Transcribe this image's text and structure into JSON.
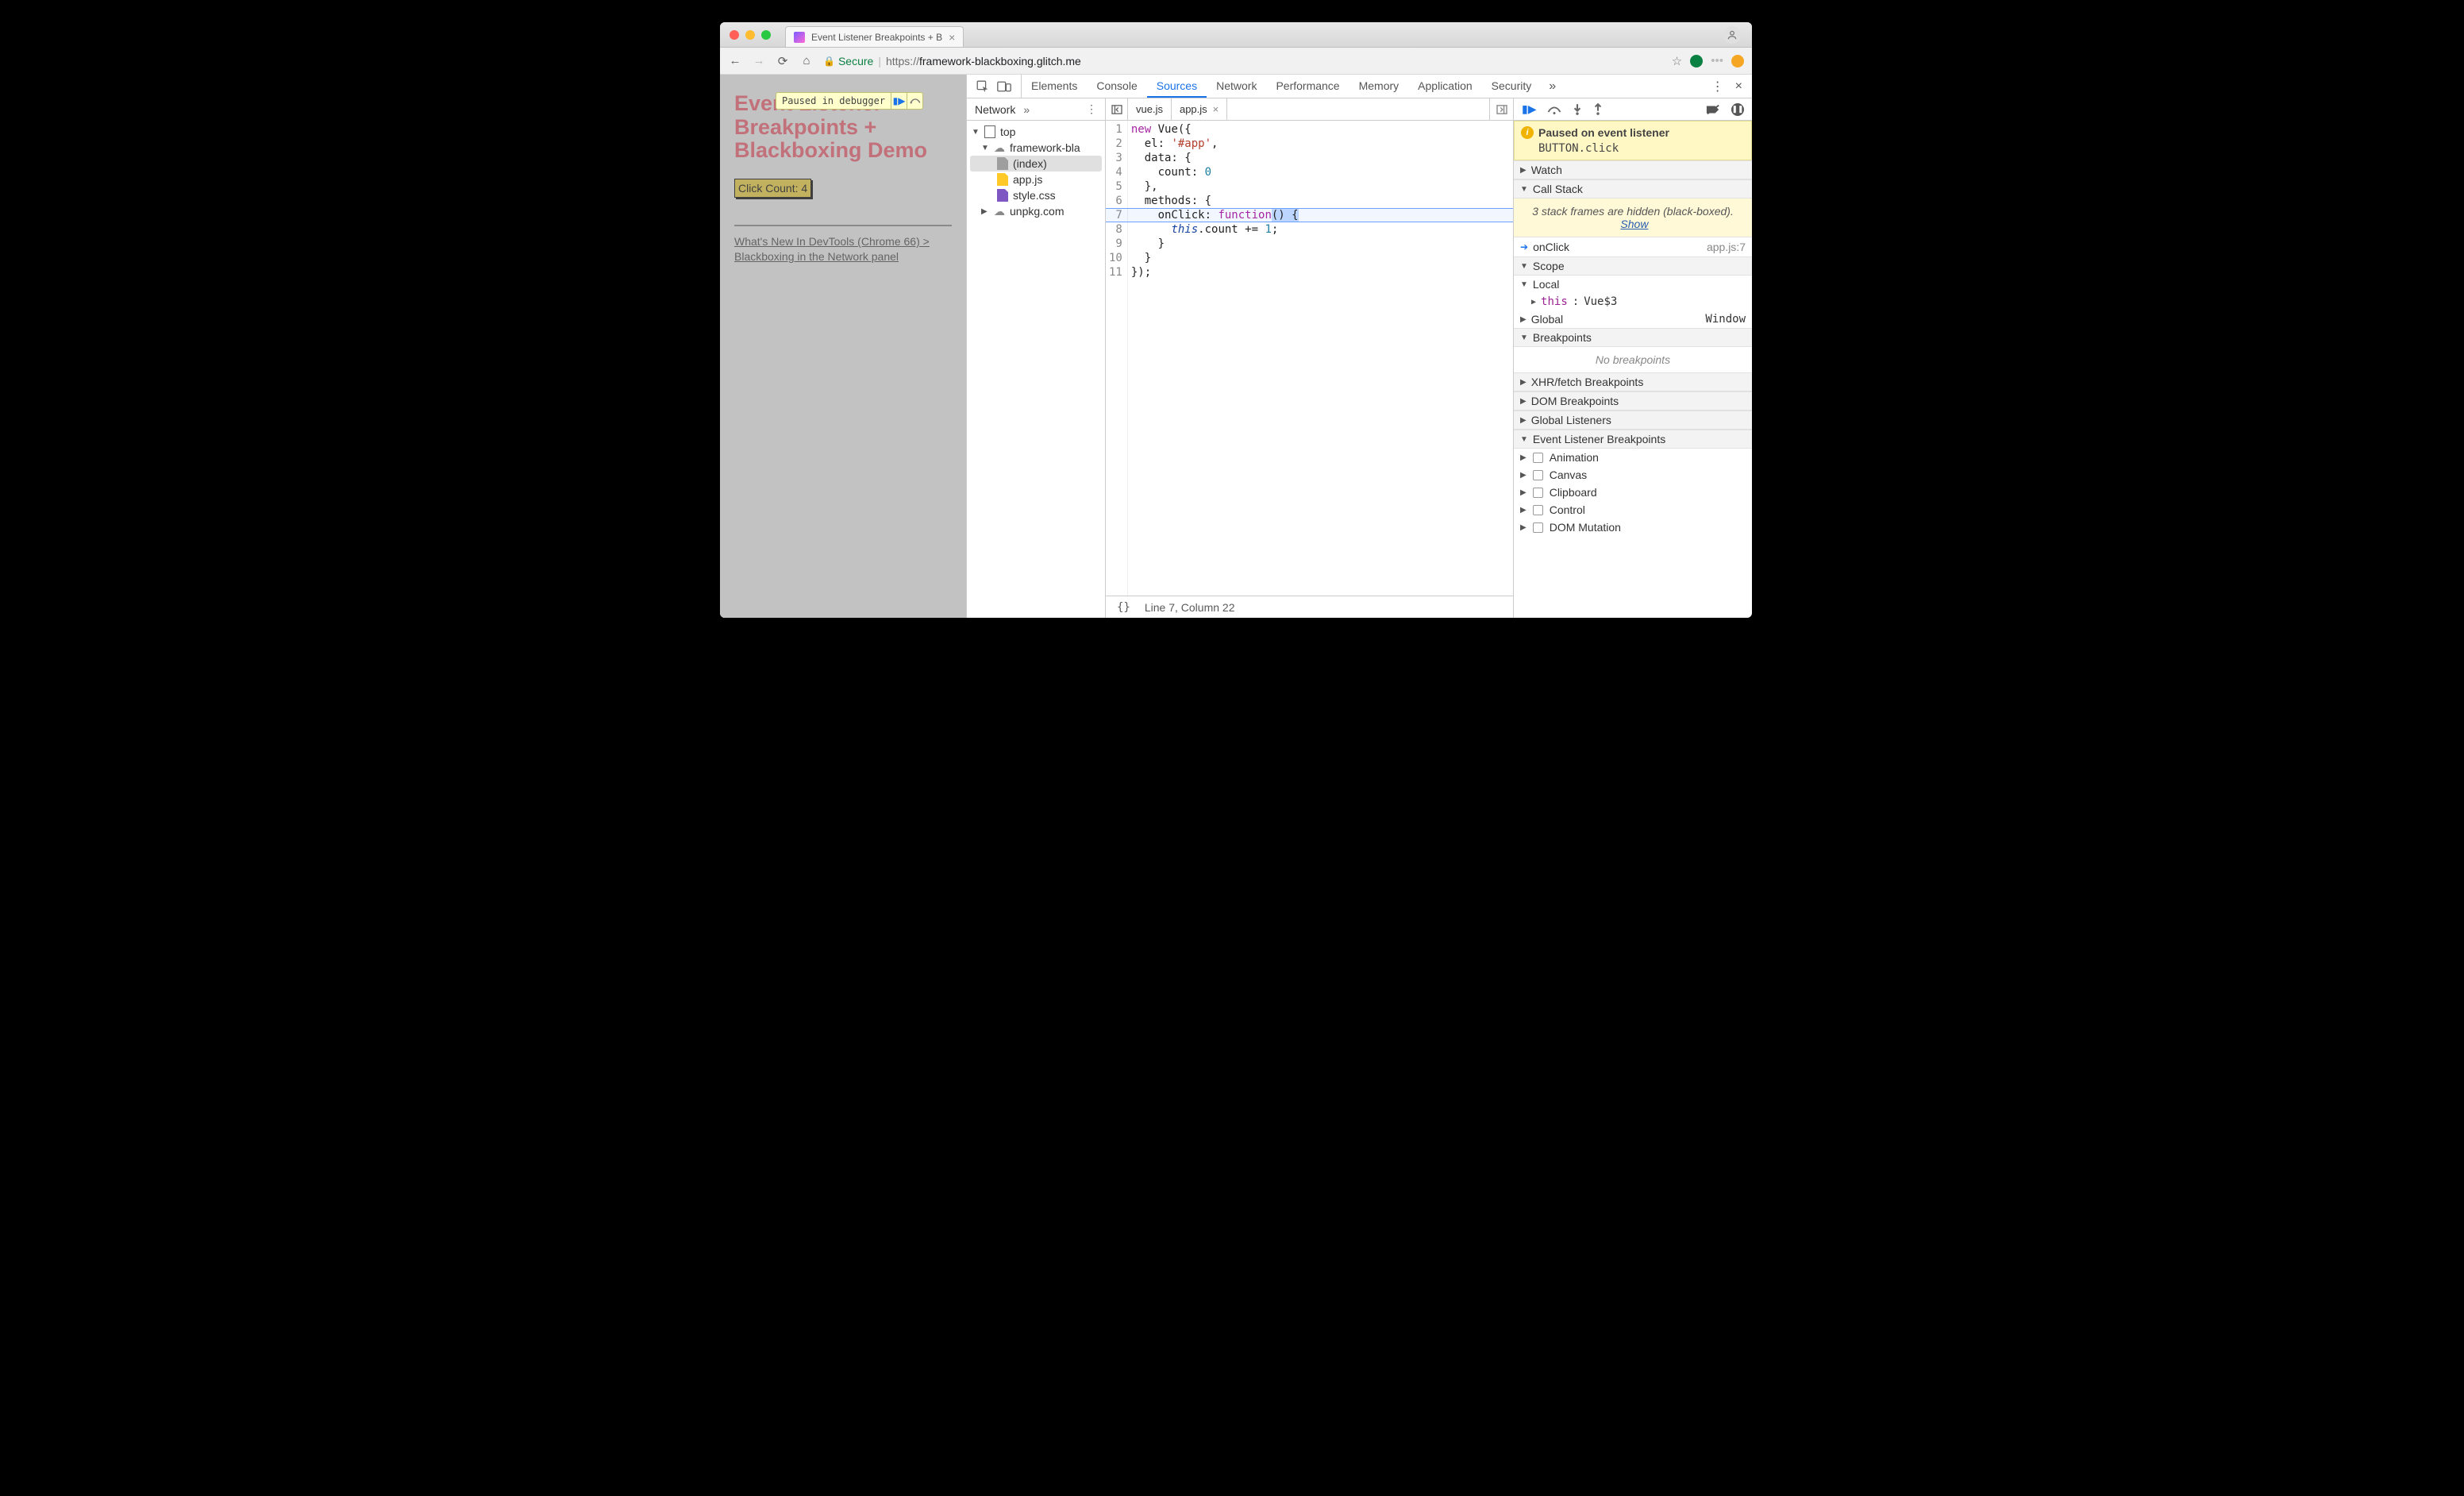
{
  "browser": {
    "tab_title": "Event Listener Breakpoints + B",
    "secure_label": "Secure",
    "url_proto": "https://",
    "url_host": "framework-blackboxing.glitch.me",
    "url_path": ""
  },
  "pause_overlay": {
    "text": "Paused in debugger"
  },
  "page": {
    "title": "Event Listener Breakpoints + Blackboxing Demo",
    "click_button": "Click Count: 4",
    "link_text": "What's New In DevTools (Chrome 66) > Blackboxing in the Network panel"
  },
  "devtools": {
    "tabs": [
      "Elements",
      "Console",
      "Sources",
      "Network",
      "Performance",
      "Memory",
      "Application",
      "Security"
    ],
    "active_tab": "Sources",
    "navigator": {
      "panel": "Network",
      "top": "top",
      "cloud_domain": "framework-bla",
      "files": [
        "(index)",
        "app.js",
        "style.css"
      ],
      "cdn": "unpkg.com"
    },
    "editor": {
      "tabs": [
        "vue.js",
        "app.js"
      ],
      "active_tab": "app.js",
      "code_lines": [
        "new Vue({",
        "  el: '#app',",
        "  data: {",
        "    count: 0",
        "  },",
        "  methods: {",
        "    onClick: function() {",
        "      this.count += 1;",
        "    }",
        "  }",
        "});"
      ],
      "highlight_line": 7,
      "status": "Line 7, Column 22"
    },
    "debugger": {
      "paused_title": "Paused on event listener",
      "paused_detail": "BUTTON.click",
      "sections": {
        "watch": "Watch",
        "callstack": "Call Stack",
        "scope": "Scope",
        "breakpoints": "Breakpoints",
        "xhr": "XHR/fetch Breakpoints",
        "dom": "DOM Breakpoints",
        "global_listeners": "Global Listeners",
        "elb": "Event Listener Breakpoints"
      },
      "blackbox_note_a": "3 stack frames are hidden (black-boxed).",
      "blackbox_show": "Show",
      "callstack": {
        "frame": "onClick",
        "location": "app.js:7"
      },
      "scope": {
        "local": "Local",
        "this_key": "this",
        "this_val": "Vue$3",
        "global": "Global",
        "global_val": "Window"
      },
      "no_breakpoints": "No breakpoints",
      "elb_items": [
        "Animation",
        "Canvas",
        "Clipboard",
        "Control",
        "DOM Mutation"
      ]
    }
  }
}
